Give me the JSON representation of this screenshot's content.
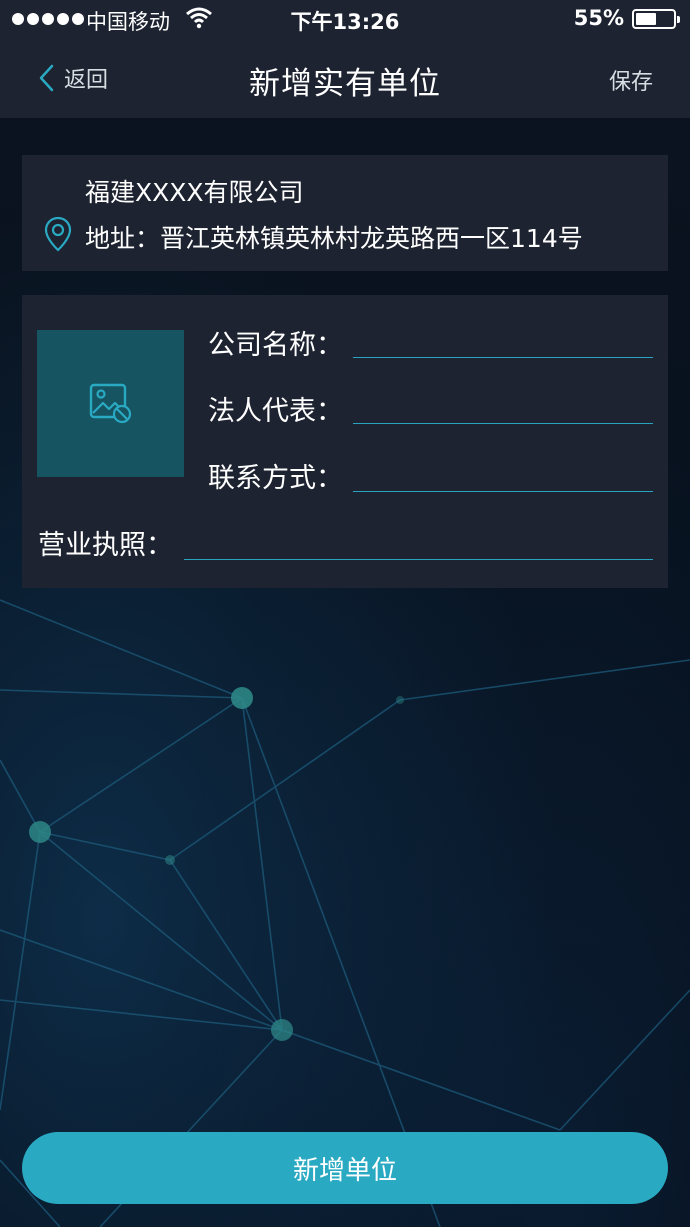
{
  "status_bar": {
    "carrier": "中国移动",
    "time": "下午13:26",
    "battery": "55%"
  },
  "nav": {
    "back_label": "返回",
    "title": "新增实有单位",
    "save_label": "保存"
  },
  "address_card": {
    "company": "福建XXXX有限公司",
    "address": "地址：晋江英林镇英林村龙英路西一区114号"
  },
  "form": {
    "company_name_label": "公司名称：",
    "company_name_value": "",
    "legal_rep_label": "法人代表：",
    "legal_rep_value": "",
    "contact_label": "联系方式：",
    "contact_value": "",
    "license_label": "营业执照：",
    "license_value": ""
  },
  "submit_label": "新增单位",
  "colors": {
    "accent": "#2aa9c3",
    "card_bg": "#1d2330",
    "photo_bg": "#155460",
    "page_bg": "#060c17"
  }
}
